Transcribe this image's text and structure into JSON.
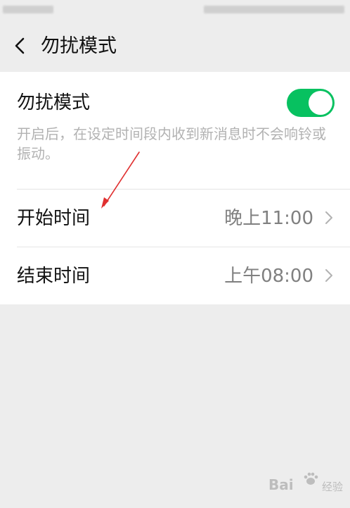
{
  "nav": {
    "back_icon": "chevron-left-icon",
    "title": "勿扰模式"
  },
  "dnd": {
    "label": "勿扰模式",
    "enabled": true,
    "toggle_color": "#07c160",
    "description": "开启后，在设定时间段内收到新消息时不会响铃或振动。"
  },
  "rows": [
    {
      "label": "开始时间",
      "value": "晚上11:00",
      "icon": "chevron-right-icon"
    },
    {
      "label": "结束时间",
      "value": "上午08:00",
      "icon": "chevron-right-icon"
    }
  ],
  "annotation": {
    "arrow_color": "#e03030"
  },
  "watermark": {
    "text": "Bai",
    "sub": "经验"
  }
}
